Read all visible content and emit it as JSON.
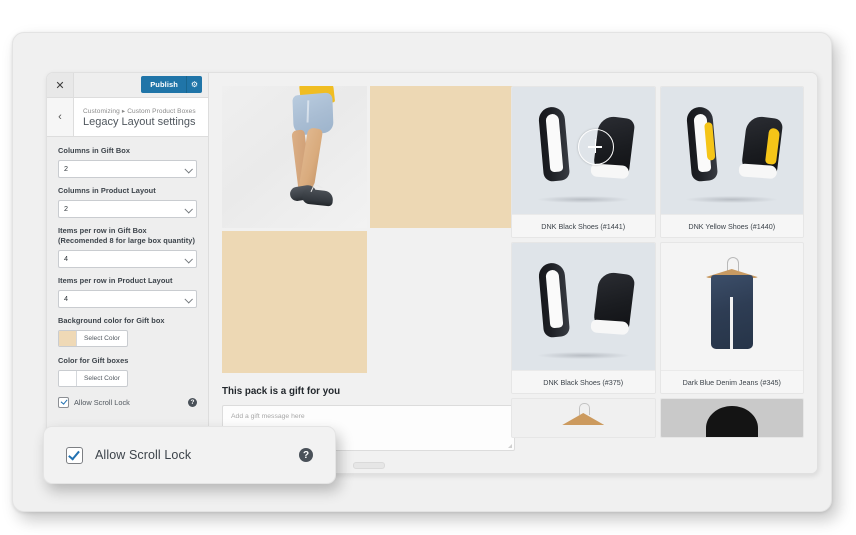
{
  "window": {
    "customizer": {
      "close_label": "✕",
      "publish_label": "Publish",
      "publish_gear_icon": "gear-icon",
      "back_label": "‹",
      "breadcrumb_parent": "Customizing",
      "breadcrumb_separator": "▸",
      "breadcrumb_current": "Custom Product Boxes",
      "panel_title": "Legacy Layout settings"
    },
    "fields": [
      {
        "label": "Columns in Gift Box",
        "value": "2",
        "type": "select"
      },
      {
        "label": "Columns in Product Layout",
        "value": "2",
        "type": "select"
      },
      {
        "label": "Items per row in Gift Box (Recomended 8 for large box quantity)",
        "value": "4",
        "type": "select"
      },
      {
        "label": "Items per row in Product Layout",
        "value": "4",
        "type": "select"
      }
    ],
    "color_fields": [
      {
        "label": "Background color for Gift box",
        "button_label": "Select Color",
        "swatch_color": "#efd9b6"
      },
      {
        "label": "Color for Gift boxes",
        "button_label": "Select Color",
        "swatch_color": "#ffffff"
      }
    ],
    "scroll_lock": {
      "label": "Allow Scroll Lock",
      "checked": true,
      "help_icon_glyph": "?"
    }
  },
  "preview": {
    "gift_box": {
      "cells": [
        {
          "kind": "photo",
          "alt": "model-wearing-denim-shorts-and-sneakers"
        },
        {
          "kind": "beige"
        },
        {
          "kind": "beige"
        },
        {
          "kind": "empty"
        }
      ],
      "beige_color": "#edd8b4"
    },
    "gift_message": {
      "title": "This pack is a gift for you",
      "placeholder": "Add a gift message here",
      "value": ""
    },
    "products": [
      {
        "name": "DNK Black Shoes (#1441)",
        "art": "shoes-black",
        "has_magnifier": true
      },
      {
        "name": "DNK Yellow Shoes (#1440)",
        "art": "shoes-yellow",
        "has_magnifier": false
      },
      {
        "name": "DNK Black Shoes (#375)",
        "art": "shoes-black",
        "has_magnifier": false
      },
      {
        "name": "Dark Blue Denim Jeans (#345)",
        "art": "jeans-hanger",
        "has_magnifier": false
      },
      {
        "name": "",
        "art": "hanger-cut",
        "has_magnifier": false
      },
      {
        "name": "",
        "art": "dark-cut",
        "has_magnifier": false
      }
    ]
  },
  "zoom_overlay": {
    "label": "Allow Scroll Lock",
    "checked": true,
    "help_icon_glyph": "?"
  },
  "colors": {
    "publish_blue": "#2075a8",
    "checkbox_blue": "#2271b1",
    "beige": "#edd8b4",
    "product_image_bg": "#dfe4e9"
  }
}
